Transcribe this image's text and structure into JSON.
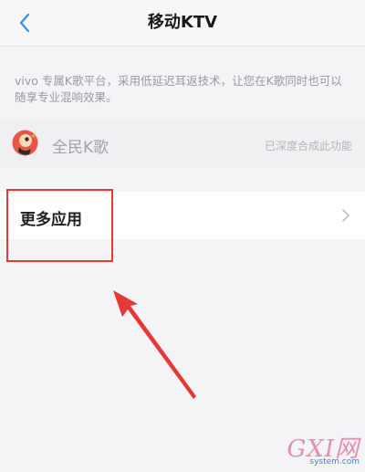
{
  "header": {
    "title": "移动KTV"
  },
  "description": "vivo 专属K歌平台，采用低延迟耳返技术，让您在K歌同时也可以随享专业混响效果。",
  "app_item": {
    "name": "全民K歌",
    "status": "已深度合成此功能"
  },
  "more_apps": {
    "label": "更多应用"
  },
  "annotation": {
    "color": "#e53935"
  },
  "watermark": {
    "logo": "GXI网",
    "domain": "system.com"
  },
  "icons": {
    "back": "chevron-left-icon",
    "app": "kge-app-icon",
    "more": "chevron-right-icon"
  }
}
